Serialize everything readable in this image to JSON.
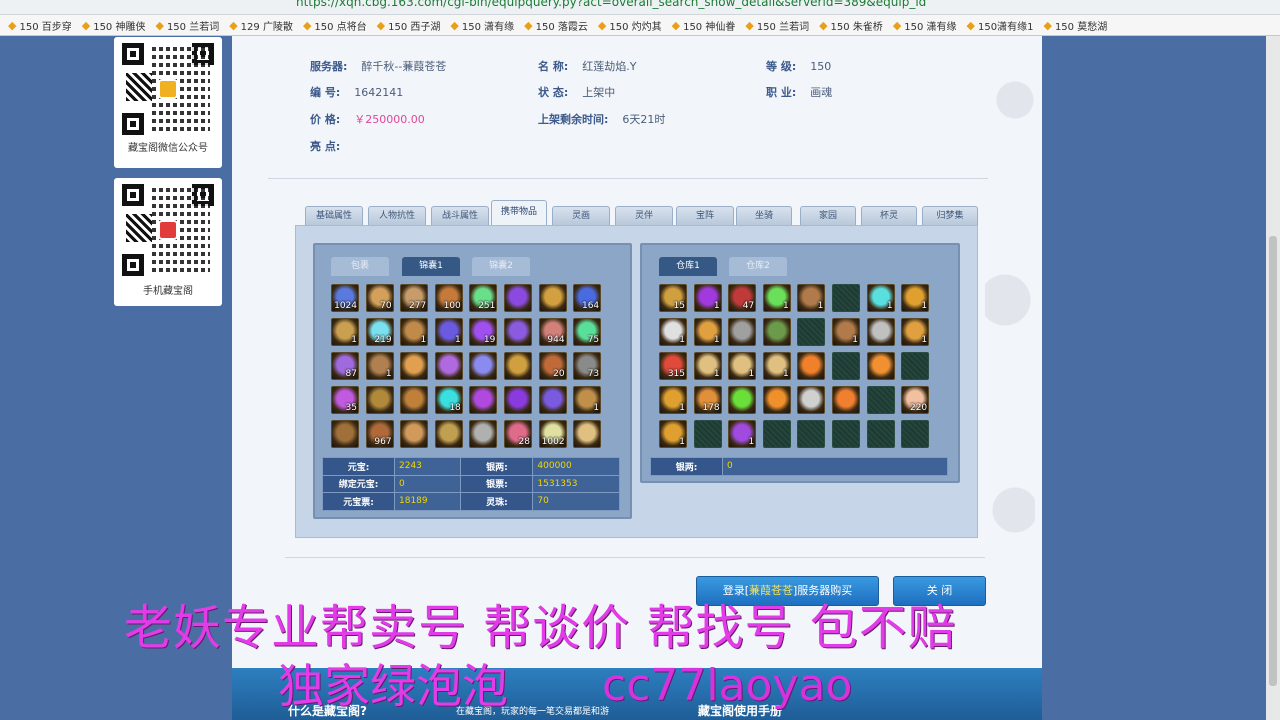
{
  "browser": {
    "url": "https://xqn.cbg.163.com/cgi-bin/equipquery.py?act=overall_search_show_detail&serverid=389&equip_id",
    "bookmarks": [
      "150 百步穿",
      "150 神雕侠",
      "150 兰若词",
      "129 广陵散",
      "150 点将台",
      "150 西子湖",
      "150 潇有缘",
      "150 落霞云",
      "150 灼灼其",
      "150 神仙眷",
      "150 兰若词",
      "150 朱雀桥",
      "150 潇有缘",
      "150潇有缘1",
      "150 莫愁湖"
    ]
  },
  "sidebar": {
    "qr1_label": "藏宝阁微信公众号",
    "qr2_label": "手机藏宝阁",
    "qr1_logo_color": "#f0b020",
    "qr2_logo_color": "#e23b3b"
  },
  "info": {
    "server_label": "服务器:",
    "server": "醉千秋--蒹葭苍苍",
    "name_label": "名 称:",
    "name": "红莲劫焰.Y",
    "level_label": "等 级:",
    "level": "150",
    "id_label": "编 号:",
    "id": "1642141",
    "status_label": "状 态:",
    "status": "上架中",
    "job_label": "职 业:",
    "job": "画魂",
    "price_label": "价 格:",
    "price": "￥250000.00",
    "remain_label": "上架剩余时间:",
    "remain": "6天21时",
    "highlight_label": "亮 点:"
  },
  "tabs": [
    "基础属性",
    "人物抗性",
    "战斗属性",
    "携带物品",
    "灵画",
    "灵伴",
    "宝阵",
    "坐骑",
    "家园",
    "杯灵",
    "归梦集"
  ],
  "active_tab": "携带物品",
  "bag": {
    "tabs": [
      "包裹",
      "锦囊1",
      "锦囊2"
    ],
    "active": "锦囊1",
    "items": [
      {
        "c": "#5a7adf",
        "n": "1024"
      },
      {
        "c": "#d2a05a",
        "n": "70"
      },
      {
        "c": "#c79b6a",
        "n": "277"
      },
      {
        "c": "#c47a3a",
        "n": "100"
      },
      {
        "c": "#6adf8a",
        "n": "251"
      },
      {
        "c": "#8a4adf",
        "n": ""
      },
      {
        "c": "#d2a040",
        "n": ""
      },
      {
        "c": "#4a6adf",
        "n": "164"
      },
      {
        "c": "#c9a050",
        "n": "1"
      },
      {
        "c": "#7ae0f0",
        "n": "219"
      },
      {
        "c": "#c08a4a",
        "n": "1"
      },
      {
        "c": "#6a5adf",
        "n": "1"
      },
      {
        "c": "#a050ef",
        "n": "19"
      },
      {
        "c": "#8a5adf",
        "n": ""
      },
      {
        "c": "#d2807a",
        "n": "944"
      },
      {
        "c": "#5adf9a",
        "n": "75"
      },
      {
        "c": "#a06adf",
        "n": "87"
      },
      {
        "c": "#b08050",
        "n": "1"
      },
      {
        "c": "#e0a050",
        "n": ""
      },
      {
        "c": "#b06adf",
        "n": ""
      },
      {
        "c": "#8a8aef",
        "n": ""
      },
      {
        "c": "#d0a040",
        "n": ""
      },
      {
        "c": "#c06a3a",
        "n": "20"
      },
      {
        "c": "#8a8a8a",
        "n": "73"
      },
      {
        "c": "#c05adf",
        "n": "35"
      },
      {
        "c": "#b08a3a",
        "n": ""
      },
      {
        "c": "#c0803a",
        "n": ""
      },
      {
        "c": "#3adfdf",
        "n": "18"
      },
      {
        "c": "#b04adf",
        "n": ""
      },
      {
        "c": "#8a3adf",
        "n": ""
      },
      {
        "c": "#7a5adf",
        "n": ""
      },
      {
        "c": "#c0904a",
        "n": "1"
      },
      {
        "c": "#a0703a",
        "n": ""
      },
      {
        "c": "#b06a3a",
        "n": "967"
      },
      {
        "c": "#d09a5a",
        "n": ""
      },
      {
        "c": "#c0a050",
        "n": ""
      },
      {
        "c": "#b0b0b0",
        "n": ""
      },
      {
        "c": "#df6a8a",
        "n": "28"
      },
      {
        "c": "#e0e0a0",
        "n": "1002"
      },
      {
        "c": "#e0c080",
        "n": ""
      }
    ]
  },
  "money": {
    "rows": [
      {
        "k1": "元宝:",
        "v1": "2243",
        "k2": "银两:",
        "v2": "400000"
      },
      {
        "k1": "绑定元宝:",
        "v1": "0",
        "k2": "银票:",
        "v2": "1531353"
      },
      {
        "k1": "元宝票:",
        "v1": "18189",
        "k2": "灵珠:",
        "v2": "70"
      }
    ]
  },
  "warehouse": {
    "tabs": [
      "仓库1",
      "仓库2"
    ],
    "active": "仓库1",
    "items": [
      {
        "c": "#d0a040",
        "n": "15"
      },
      {
        "c": "#a03adf",
        "n": "1"
      },
      {
        "c": "#c03a3a",
        "n": "47"
      },
      {
        "c": "#6adf5a",
        "n": "1"
      },
      {
        "c": "#b07a4a",
        "n": "1"
      },
      {
        "c": "",
        "n": ""
      },
      {
        "c": "#5adfdf",
        "n": "1"
      },
      {
        "c": "#e0a030",
        "n": "1"
      },
      {
        "c": "#e0e0e0",
        "n": "1"
      },
      {
        "c": "#e0a040",
        "n": "1"
      },
      {
        "c": "#a0a0a0",
        "n": ""
      },
      {
        "c": "#6a9a4a",
        "n": ""
      },
      {
        "c": "",
        "n": ""
      },
      {
        "c": "#b07a4a",
        "n": "1"
      },
      {
        "c": "#c0c0c0",
        "n": ""
      },
      {
        "c": "#e0a040",
        "n": "1"
      },
      {
        "c": "#df4a3a",
        "n": "315"
      },
      {
        "c": "#e0c080",
        "n": "1"
      },
      {
        "c": "#e0c080",
        "n": "1"
      },
      {
        "c": "#e0c080",
        "n": "1"
      },
      {
        "c": "#f0802a",
        "n": ""
      },
      {
        "c": "",
        "n": ""
      },
      {
        "c": "#f09030",
        "n": ""
      },
      {
        "c": "",
        "n": ""
      },
      {
        "c": "#e0a030",
        "n": "1"
      },
      {
        "c": "#e0903a",
        "n": "178"
      },
      {
        "c": "#6adf3a",
        "n": ""
      },
      {
        "c": "#f0902a",
        "n": ""
      },
      {
        "c": "#d0d0d0",
        "n": ""
      },
      {
        "c": "#f08030",
        "n": ""
      },
      {
        "c": "",
        "n": ""
      },
      {
        "c": "#f0c0a0",
        "n": "220"
      },
      {
        "c": "#e0a030",
        "n": "1"
      },
      {
        "c": "",
        "n": ""
      },
      {
        "c": "#a04adf",
        "n": "1"
      },
      {
        "c": "",
        "n": ""
      },
      {
        "c": "",
        "n": ""
      },
      {
        "c": "",
        "n": ""
      },
      {
        "c": "",
        "n": ""
      },
      {
        "c": "",
        "n": ""
      }
    ],
    "silver_label": "银两:",
    "silver": "0"
  },
  "buttons": {
    "buy_prefix": "登录[",
    "buy_server": "蒹葭苍苍",
    "buy_suffix": "]服务器购买",
    "close": "关 闭"
  },
  "footer": {
    "left": "什么是藏宝阁?",
    "mid": "在藏宝阁，玩家的每一笔交易都是和游",
    "right": "藏宝阁使用手册"
  },
  "overlay": {
    "line1": "老妖专业帮卖号 帮谈价 帮找号 包不赔",
    "line2": "独家绿泡泡",
    "contact": "cc77laoyao"
  }
}
